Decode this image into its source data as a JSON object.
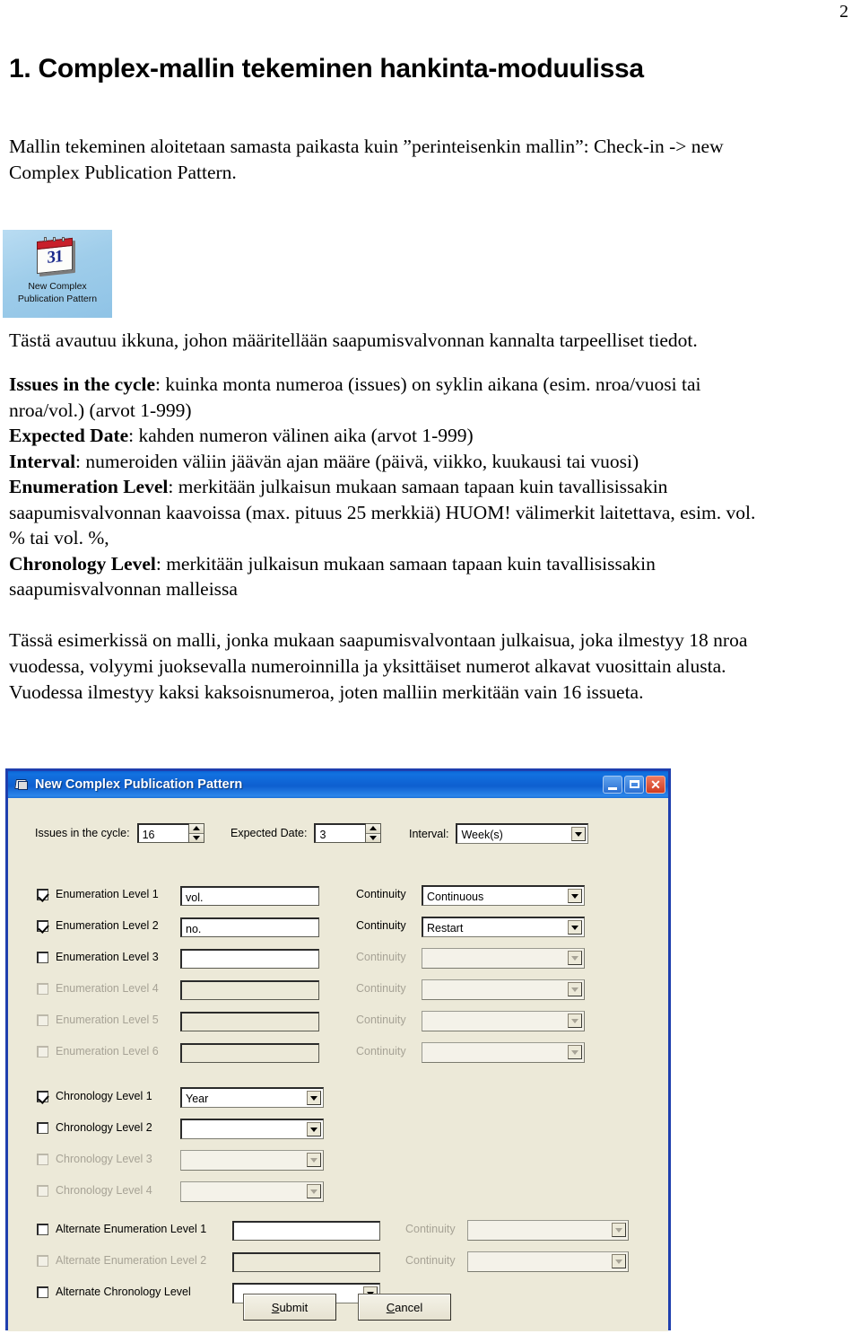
{
  "page": {
    "number": "2"
  },
  "document": {
    "heading": "1. Complex-mallin tekeminen hankinta-moduulissa",
    "intro_line1": "Mallin tekeminen aloitetaan samasta paikasta kuin ”perinteisenkin mallin”: Check-in -> new",
    "intro_line2": "Complex Publication Pattern.",
    "after_icon": "Tästä avautuu ikkuna, johon määritellään saapumisvalvonnan kannalta tarpeelliset tiedot.",
    "definitions": [
      {
        "term": "Issues in the cycle",
        "rest": ": kuinka monta numeroa (issues) on syklin aikana (esim. nroa/vuosi tai"
      },
      {
        "term": "",
        "rest": "nroa/vol.) (arvot 1-999)"
      },
      {
        "term": "Expected Date",
        "rest": ": kahden numeron välinen aika (arvot 1-999)"
      },
      {
        "term": "Interval",
        "rest": ": numeroiden väliin jäävän ajan määre (päivä, viikko, kuukausi tai vuosi)"
      },
      {
        "term": "Enumeration Level",
        "rest": ": merkitään julkaisun mukaan samaan tapaan kuin tavallisissakin"
      },
      {
        "term": "",
        "rest": "saapumisvalvonnan kaavoissa (max. pituus 25 merkkiä) HUOM! välimerkit laitettava, esim. vol."
      },
      {
        "term": "",
        "rest": "% tai vol. %,"
      },
      {
        "term": "Chronology Level",
        "rest": ": merkitään julkaisun mukaan samaan tapaan kuin tavallisissakin"
      },
      {
        "term": "",
        "rest": "saapumisvalvonnan malleissa"
      }
    ],
    "closing": [
      "Tässä esimerkissä on malli, jonka mukaan saapumisvalvontaan julkaisua, joka ilmestyy 18 nroa",
      "vuodessa, volyymi juoksevalla numeroinnilla ja yksittäiset numerot alkavat vuosittain alusta.",
      "Vuodessa ilmestyy kaksi kaksoisnumeroa, joten malliin merkitään vain 16 issueta."
    ]
  },
  "desktop_icon": {
    "name": "new-complex-publication-pattern-icon",
    "calendar_day": "31",
    "label_line1": "New Complex",
    "label_line2": "Publication Pattern"
  },
  "dialog": {
    "title": "New Complex Publication Pattern",
    "titlebar_color": "#0e5fd0",
    "background_color": "#ece9d8",
    "window_buttons": {
      "minimize": "minimize",
      "maximize": "maximize",
      "close": "close"
    },
    "top_fields": [
      {
        "label": "Issues in the cycle:",
        "value": "16",
        "control": "spinner"
      },
      {
        "label": "Expected Date:",
        "value": "3",
        "control": "spinner"
      },
      {
        "label": "Interval:",
        "value": "Week(s)",
        "control": "combo"
      }
    ],
    "continuity_label": "Continuity",
    "enumeration_levels": [
      {
        "label": "Enumeration Level 1",
        "checked": true,
        "enabled": true,
        "value": "vol.",
        "continuity": "Continuous",
        "continuity_enabled": true
      },
      {
        "label": "Enumeration Level 2",
        "checked": true,
        "enabled": true,
        "value": "no.",
        "continuity": "Restart",
        "continuity_enabled": true
      },
      {
        "label": "Enumeration Level 3",
        "checked": false,
        "enabled": true,
        "value": "",
        "continuity": "",
        "continuity_enabled": false
      },
      {
        "label": "Enumeration Level 4",
        "checked": false,
        "enabled": false,
        "value": "",
        "continuity": "",
        "continuity_enabled": false
      },
      {
        "label": "Enumeration Level 5",
        "checked": false,
        "enabled": false,
        "value": "",
        "continuity": "",
        "continuity_enabled": false
      },
      {
        "label": "Enumeration Level 6",
        "checked": false,
        "enabled": false,
        "value": "",
        "continuity": "",
        "continuity_enabled": false
      }
    ],
    "chronology_levels": [
      {
        "label": "Chronology Level 1",
        "checked": true,
        "enabled": true,
        "value": "Year"
      },
      {
        "label": "Chronology Level 2",
        "checked": false,
        "enabled": true,
        "value": ""
      },
      {
        "label": "Chronology Level 3",
        "checked": false,
        "enabled": false,
        "value": ""
      },
      {
        "label": "Chronology Level 4",
        "checked": false,
        "enabled": false,
        "value": ""
      }
    ],
    "alternate_enumeration": [
      {
        "label": "Alternate Enumeration Level 1",
        "checked": false,
        "enabled": true,
        "value": "",
        "continuity": "",
        "continuity_enabled": false
      },
      {
        "label": "Alternate Enumeration Level 2",
        "checked": false,
        "enabled": false,
        "value": "",
        "continuity": "",
        "continuity_enabled": false
      }
    ],
    "alternate_chronology": {
      "label": "Alternate Chronology Level",
      "checked": false,
      "enabled": true,
      "value": ""
    },
    "buttons": {
      "submit": "Submit",
      "submit_accel": "S",
      "cancel": "Cancel",
      "cancel_accel": "C"
    }
  }
}
